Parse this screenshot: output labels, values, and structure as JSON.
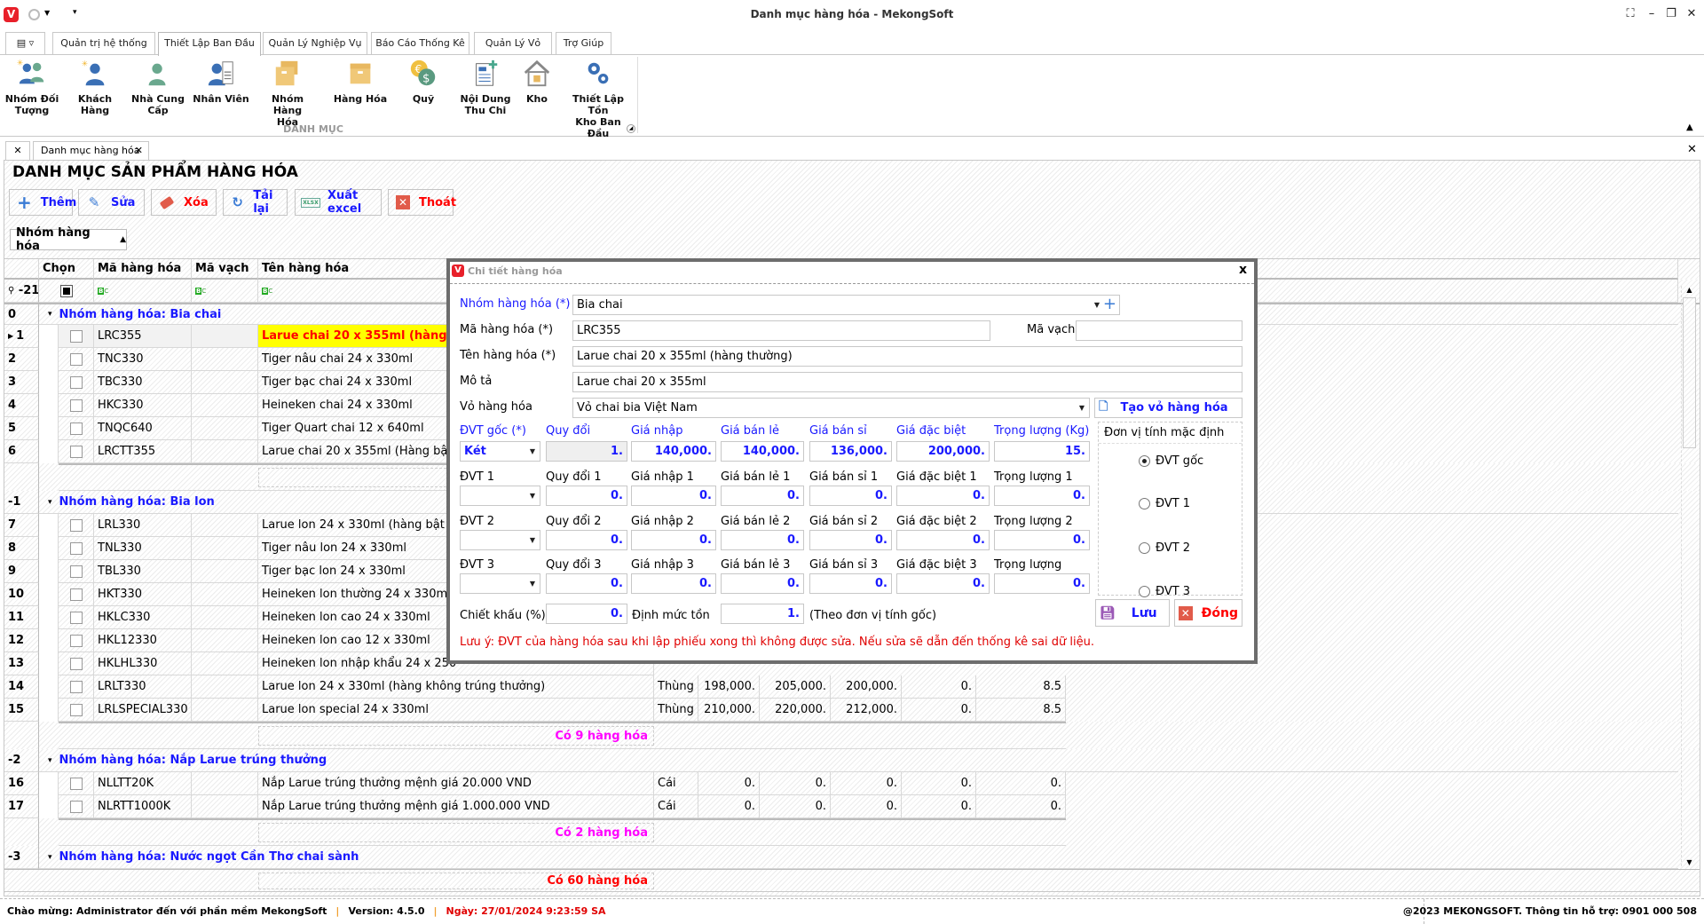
{
  "window": {
    "title": "Danh mục hàng hóa - MekongSoft",
    "controls": [
      "restore-screen-icon",
      "minimize-icon",
      "maximize-icon",
      "close-icon"
    ]
  },
  "ribbon": {
    "tabs": [
      "Quản trị hệ thống",
      "Thiết Lập Ban Đầu",
      "Quản Lý Nghiệp Vụ",
      "Báo Cáo Thống Kê",
      "Quản Lý Vỏ",
      "Trợ Giúp"
    ],
    "active_tab": "Thiết Lập Ban Đầu",
    "group_label": "DANH MỤC",
    "items": [
      {
        "label": "Nhóm Đối\nTượng",
        "icon": "user-group-icon"
      },
      {
        "label": "Khách\nHàng",
        "icon": "customer-icon"
      },
      {
        "label": "Nhà Cung\nCấp",
        "icon": "supplier-icon"
      },
      {
        "label": "Nhân Viên",
        "icon": "employee-icon"
      },
      {
        "label": "Nhóm Hàng\nHóa",
        "icon": "product-group-icon"
      },
      {
        "label": "Hàng Hóa",
        "icon": "product-box-icon"
      },
      {
        "label": "Quỹ",
        "icon": "fund-coins-icon"
      },
      {
        "label": "Nội Dung\nThu Chi",
        "icon": "document-add-icon"
      },
      {
        "label": "Kho",
        "icon": "warehouse-icon"
      },
      {
        "label": "Thiết Lập Tồn\nKho Ban Đầu",
        "icon": "gears-icon"
      }
    ]
  },
  "doc_tab": {
    "label": "Danh mục hàng hóa"
  },
  "page": {
    "title": "DANH MỤC SẢN PHẨM HÀNG HÓA",
    "toolbar": [
      {
        "label": "Thêm",
        "icon": "plus-icon",
        "color": "#1a1aff"
      },
      {
        "label": "Sửa",
        "icon": "pencil-icon",
        "color": "#1a1aff"
      },
      {
        "label": "Xóa",
        "icon": "eraser-icon",
        "color": "#ff0000"
      },
      {
        "label": "Tải lại",
        "icon": "refresh-icon",
        "color": "#1a1aff"
      },
      {
        "label": "Xuất excel",
        "icon": "excel-icon",
        "color": "#1a1aff"
      },
      {
        "label": "Thoát",
        "icon": "exit-icon",
        "color": "#ff0000"
      }
    ],
    "group_by_chip": "Nhóm hàng hóa"
  },
  "grid": {
    "columns": [
      "Chọn",
      "Mã hàng hóa",
      "Mã vạch",
      "Tên hàng hóa"
    ],
    "filter_row_label": "-21",
    "groups": [
      {
        "index": "0",
        "label": "Nhóm hàng hóa: Bia chai",
        "footer": "",
        "rows": [
          {
            "no": "1",
            "code": "LRC355",
            "name": "Larue chai 20 x 355ml (hàng thường)",
            "selected": true
          },
          {
            "no": "2",
            "code": "TNC330",
            "name": "Tiger nâu chai 24 x 330ml"
          },
          {
            "no": "3",
            "code": "TBC330",
            "name": "Tiger bạc chai 24 x 330ml"
          },
          {
            "no": "4",
            "code": "HKC330",
            "name": "Heineken chai 24 x 330ml"
          },
          {
            "no": "5",
            "code": "TNQC640",
            "name": "Tiger Quart chai 12 x 640ml"
          },
          {
            "no": "6",
            "code": "LRCTT355",
            "name": "Larue chai 20 x 355ml (Hàng bật"
          }
        ]
      },
      {
        "index": "-1",
        "label": "Nhóm hàng hóa: Bia lon",
        "footer": "Có 9 hàng hóa",
        "rows": [
          {
            "no": "7",
            "code": "LRL330",
            "name": "Larue lon 24 x 330ml (hàng bật n"
          },
          {
            "no": "8",
            "code": "TNL330",
            "name": "Tiger nâu lon 24 x 330ml"
          },
          {
            "no": "9",
            "code": "TBL330",
            "name": "Tiger bạc lon 24 x 330ml"
          },
          {
            "no": "10",
            "code": "HKT330",
            "name": "Heineken lon thường 24 x 330ml"
          },
          {
            "no": "11",
            "code": "HKLC330",
            "name": "Heineken lon cao 24 x 330ml"
          },
          {
            "no": "12",
            "code": "HKL12330",
            "name": "Heineken lon cao 12 x 330ml"
          },
          {
            "no": "13",
            "code": "HKLHL330",
            "name": "Heineken lon nhập khẩu 24 x 250"
          },
          {
            "no": "14",
            "code": "LRLT330",
            "name": "Larue lon 24 x 330ml (hàng không trúng thưởng)",
            "unit": "Thùng",
            "vals": [
              "198,000.",
              "205,000.",
              "200,000.",
              "0.",
              "8.5"
            ]
          },
          {
            "no": "15",
            "code": "LRLSPECIAL330",
            "name": "Larue lon special 24 x 330ml",
            "unit": "Thùng",
            "vals": [
              "210,000.",
              "220,000.",
              "212,000.",
              "0.",
              "8.5"
            ]
          }
        ]
      },
      {
        "index": "-2",
        "label": "Nhóm hàng hóa: Nắp Larue trúng thưởng",
        "footer": "Có 2 hàng hóa",
        "rows": [
          {
            "no": "16",
            "code": "NLLTT20K",
            "name": "Nắp Larue trúng thưởng mệnh giá 20.000 VND",
            "unit": "Cái",
            "vals": [
              "0.",
              "0.",
              "0.",
              "0.",
              "0."
            ]
          },
          {
            "no": "17",
            "code": "NLRTT1000K",
            "name": "Nắp Larue trúng thưởng mệnh giá 1.000.000 VND",
            "unit": "Cái",
            "vals": [
              "0.",
              "0.",
              "0.",
              "0.",
              "0."
            ]
          }
        ]
      },
      {
        "index": "-3",
        "label": "Nhóm hàng hóa: Nước ngọt Cần Thơ chai sành",
        "collapsed": true,
        "rows": []
      }
    ],
    "grand_total": "Có 60 hàng hóa",
    "colors": {
      "group": "#1a1aff",
      "footer": "#ff00ff",
      "total": "#ff0000",
      "selected_cell_bg": "#ffff00",
      "selected_text": "#ff0000"
    }
  },
  "dialog": {
    "title": "Chi tiết hàng hóa",
    "fields": {
      "group_label": "Nhóm hàng hóa (*)",
      "group_value": "Bia chai",
      "code_label": "Mã hàng hóa (*)",
      "code_value": "LRC355",
      "barcode_label": "Mã vạch",
      "barcode_value": "",
      "name_label": "Tên hàng hóa (*)",
      "name_value": "Larue chai 20 x 355ml (hàng thường)",
      "desc_label": "Mô tả",
      "desc_value": "Larue chai 20 x 355ml",
      "shell_label": "Vỏ hàng hóa",
      "shell_value": "Vỏ chai bia Việt Nam",
      "create_shell_button": "Tạo vỏ hàng hóa"
    },
    "units": [
      {
        "labels": [
          "ĐVT gốc (*)",
          "Quy đổi",
          "Giá nhập",
          "Giá bán lẻ",
          "Giá bán sỉ",
          "Giá đặc biệt",
          "Trọng lượng (Kg)"
        ],
        "unit": "Két",
        "values": [
          "1.",
          "140,000.",
          "140,000.",
          "136,000.",
          "200,000.",
          "15."
        ]
      },
      {
        "labels": [
          "ĐVT 1",
          "Quy đổi  1",
          "Giá nhập 1",
          "Giá bán lẻ 1",
          "Giá bán sỉ 1",
          "Giá đặc biệt 1",
          "Trọng lượng 1"
        ],
        "unit": "",
        "values": [
          "0.",
          "0.",
          "0.",
          "0.",
          "0.",
          "0."
        ]
      },
      {
        "labels": [
          "ĐVT 2",
          "Quy đổi 2",
          "Giá nhập 2",
          "Giá bán lẻ 2",
          "Giá bán sỉ 2",
          "Giá đặc biệt 2",
          "Trọng lượng 2"
        ],
        "unit": "",
        "values": [
          "0.",
          "0.",
          "0.",
          "0.",
          "0.",
          "0."
        ]
      },
      {
        "labels": [
          "ĐVT 3",
          "Quy đổi 3",
          "Giá nhập 3",
          "Giá bán lẻ 3",
          "Giá bán sỉ 3",
          "Giá đặc biệt 3",
          "Trọng lượng"
        ],
        "unit": "",
        "values": [
          "0.",
          "0.",
          "0.",
          "0.",
          "0.",
          "0."
        ]
      }
    ],
    "discount_label": "Chiết khấu (%)",
    "discount_value": "0.",
    "min_stock_label": "Định mức tồn",
    "min_stock_value": "1.",
    "min_stock_note": "(Theo đơn vị tính gốc)",
    "default_unit": {
      "title": "Đơn vị tính mặc định",
      "options": [
        "ĐVT gốc",
        "ĐVT 1",
        "ĐVT 2",
        "ĐVT 3"
      ],
      "selected": "ĐVT gốc"
    },
    "save_button": "Lưu",
    "close_button": "Đóng",
    "note": "Lưu ý: ĐVT của hàng hóa sau khi lập  phiếu xong thì không được sửa. Nếu sửa sẽ dẫn đến thống kê sai dữ liệu."
  },
  "status": {
    "welcome": "Chào mừng: Administrator đến với phần mềm MekongSoft",
    "version": "Version: 4.5.0",
    "date": "Ngày: 27/01/2024 9:23:59 SA",
    "copyright": "@2023 MEKONGSOFT. Thông tin hỗ trợ: 0901 000 508"
  }
}
